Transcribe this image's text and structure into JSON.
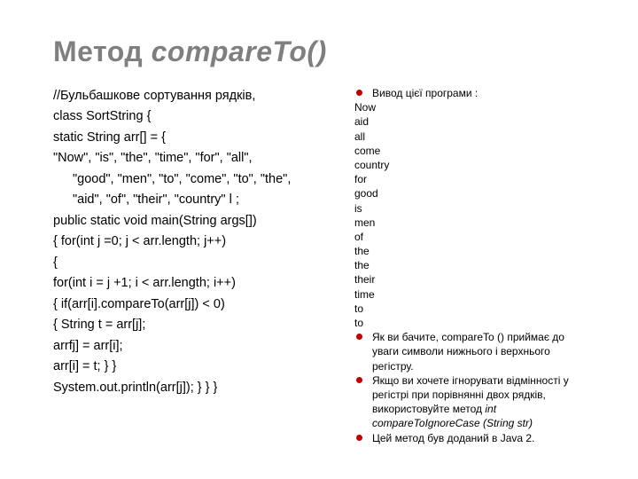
{
  "title": {
    "prefix": "Метод ",
    "name": "compareTo()"
  },
  "code": {
    "l1": "//Бульбашкове сортування рядків,",
    "l2": "class SortString {",
    "l3": "static String arr[] = {",
    "l4": "\"Now\", \"is\", \"the\", \"time\", \"for\", \"all\",",
    "l5": "\"good\", \"men\", \"to\", \"come\", \"to\", \"the\",",
    "l6": "\"aid\", \"of\", \"their\", \"country\" l ;",
    "l7": "public static void main(String args[])",
    "l8": "{ for(int j =0; j < arr.length; j++)",
    "l9": "{",
    "l10": "for(int i = j +1; i < arr.length; i++)",
    "l11": " { if(arr[i].compareTo(arr[j]) < 0)",
    "l12": "{ String t = arr[j];",
    "l13": "arrfj] = arr[i];",
    "l14": "arr[i] = t; } }",
    "l15": "System.out.println(arr[j]); } } }"
  },
  "out": {
    "header": "Вивод цієї програми :",
    "lines": [
      "Now",
      "aid",
      "all",
      "come",
      "country",
      "for",
      "good",
      "is",
      "men",
      "of",
      "the",
      "the",
      "their",
      "time",
      "to",
      "to"
    ],
    "b1": "Як ви бачите, compareTo () приймає до уваги символи нижнього і верхнього регістру.",
    "b2a": "Якщо ви хочете ігнорувати відмінності у регістрі при порівнянні двох рядків, використовуйте метод ",
    "b2b": "int compareToIgnoreCase (String str)",
    "b3": "Цей метод був доданий в Java 2."
  }
}
